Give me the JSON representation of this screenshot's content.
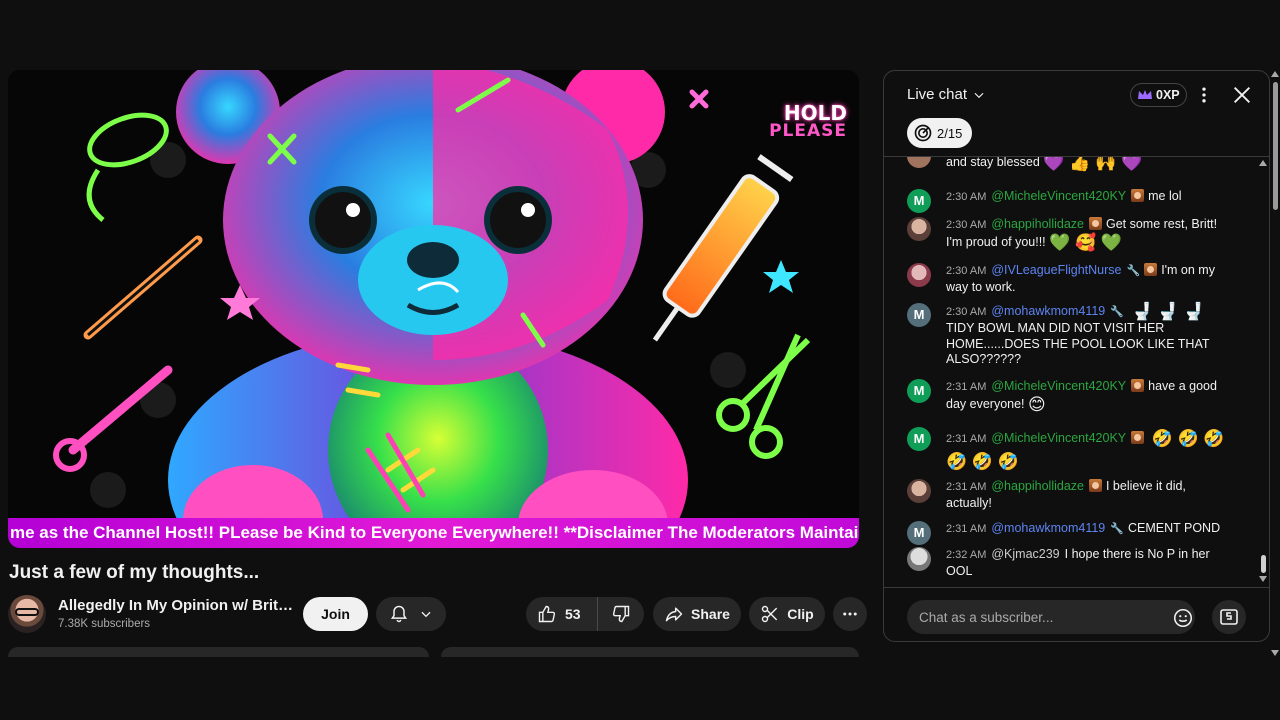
{
  "video": {
    "overlay_line1": "HOLD",
    "overlay_line2": "PLEASE",
    "ticker": "me as the Channel Host!! PLease be Kind to Everyone Everywhere!! **Disclaimer The Moderators Maintain"
  },
  "title": "Just a few of my thoughts...",
  "channel": {
    "name": "Allegedly In My Opinion w/ Brittany",
    "subscribers": "7.38K subscribers",
    "join_label": "Join"
  },
  "actions": {
    "likes": "53",
    "share_label": "Share",
    "clip_label": "Clip"
  },
  "chat": {
    "title": "Live chat",
    "xp": "0XP",
    "goal": "2/15",
    "input_placeholder": "Chat as a subscriber...",
    "messages": [
      {
        "time": "",
        "author": "",
        "text": "and stay blessed",
        "emoji": "💜 👍 🙌 💜"
      },
      {
        "time": "2:30 AM",
        "author": "@MicheleVincent420KY",
        "text": "me lol",
        "initial": "M"
      },
      {
        "time": "2:30 AM",
        "author": "@happihollidaze",
        "text": "Get some rest, Britt! I'm proud of you!!!",
        "emoji": "💚 🥰 💚"
      },
      {
        "time": "2:30 AM",
        "author": "@IVLeagueFlightNurse",
        "text": "I'm on my way to work."
      },
      {
        "time": "2:30 AM",
        "author": "@mohawkmom4119",
        "text": "TIDY BOWL MAN DID NOT VISIT HER HOME......DOES THE POOL LOOK LIKE THAT ALSO??????",
        "emoji": "🚽 🚽 🚽",
        "initial": "M"
      },
      {
        "time": "2:31 AM",
        "author": "@MicheleVincent420KY",
        "text": "have a good day everyone!",
        "emoji": "😊",
        "initial": "M"
      },
      {
        "time": "2:31 AM",
        "author": "@MicheleVincent420KY",
        "emoji": "🤣 🤣 🤣",
        "emoji2": "🤣 🤣 🤣",
        "initial": "M"
      },
      {
        "time": "2:31 AM",
        "author": "@happihollidaze",
        "text": "I believe it did, actually!"
      },
      {
        "time": "2:31 AM",
        "author": "@mohawkmom4119",
        "text": "CEMENT POND",
        "initial": "M"
      },
      {
        "time": "2:32 AM",
        "author": "@Kjmac239",
        "text": "I hope there is No P in her OOL"
      }
    ]
  },
  "colors": {
    "accent_green": "#2ba640",
    "accent_blue": "#5e84f1",
    "ticker_magenta": "#d414d6"
  }
}
